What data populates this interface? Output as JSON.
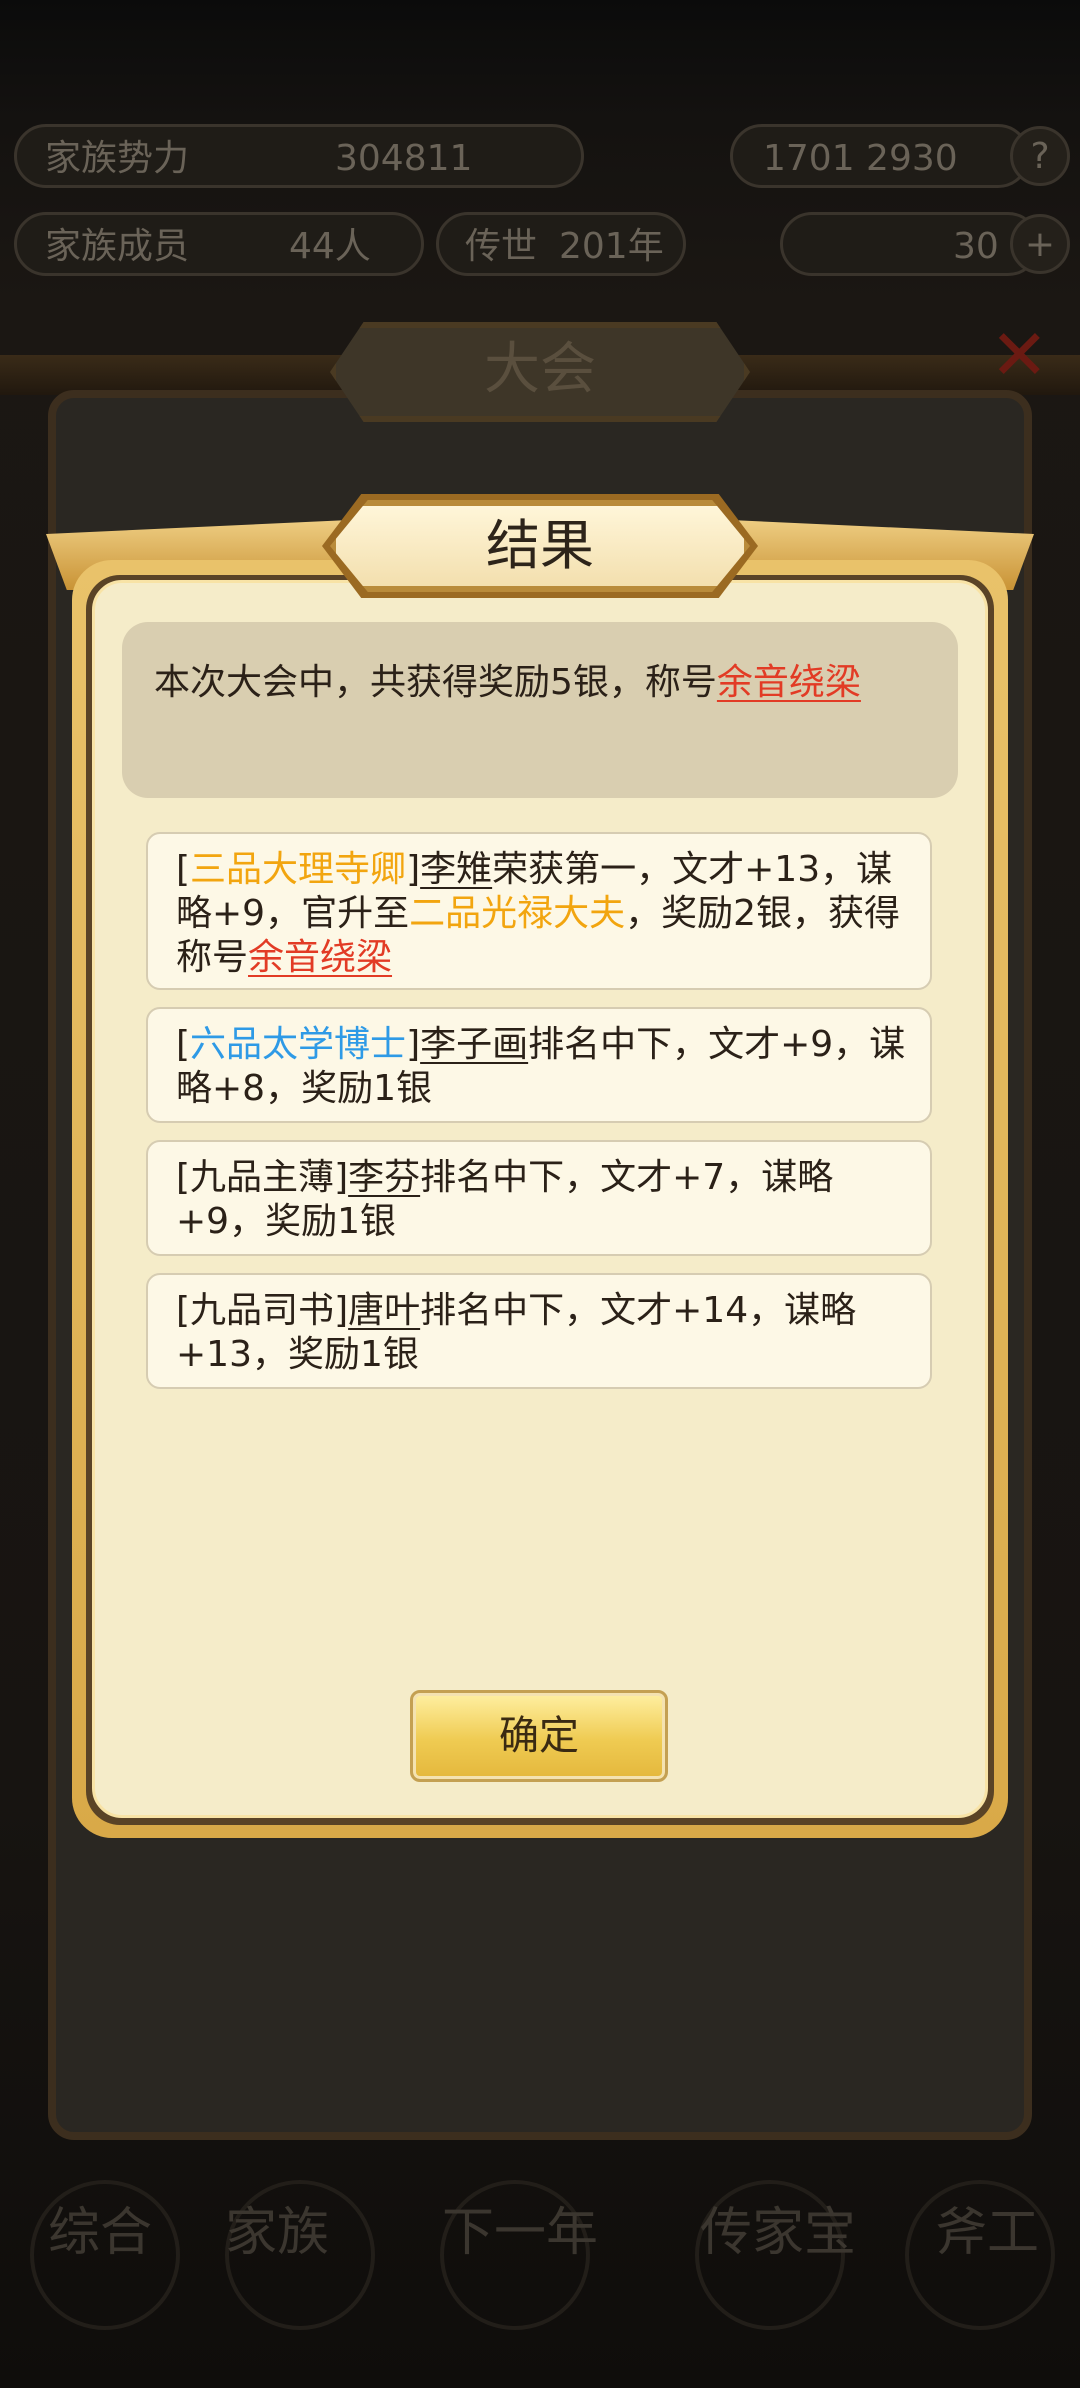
{
  "background": {
    "top_left_label": "家族势力",
    "top_left_value": "304811",
    "top_right_value": "1701 2930",
    "members_label": "家族成员",
    "members_value": "44人",
    "year_label": "传世",
    "year_value": "201年",
    "right_count": "30",
    "panel_title": "大会",
    "nav": [
      "综合",
      "家族",
      "下一年",
      "传家宝",
      "斧工"
    ]
  },
  "dialog": {
    "title": "结果",
    "summary_text": "本次大会中，共获得奖励5银，称号",
    "summary_title": "余音绕梁",
    "confirm_label": "确定"
  },
  "entries": [
    {
      "rank": "三品大理寺卿",
      "name": "李雉",
      "text1": "荣获第一，文才+13，谋略+9，官升至",
      "promotion": "二品光禄大夫",
      "text2": "，奖励2银，获得称号",
      "earned_title": "余音绕梁"
    },
    {
      "rank": "六品太学博士",
      "name": "李子画",
      "text1": "排名中下，文才+9，谋略+8，奖励1银"
    },
    {
      "rank": "九品主薄",
      "name": "李芬",
      "text1": "排名中下，文才+7，谋略+9，奖励1银"
    },
    {
      "rank": "九品司书",
      "name": "唐叶",
      "text1": "排名中下，文才+14，谋略+13，奖励1银"
    }
  ],
  "colors": {
    "rank_gold": "#f2a50f",
    "rank_blue": "#2e9ae6",
    "title_red": "#e23b25",
    "dialog_bg": "#f5ecc9",
    "confirm_gold": "#efcb52"
  }
}
